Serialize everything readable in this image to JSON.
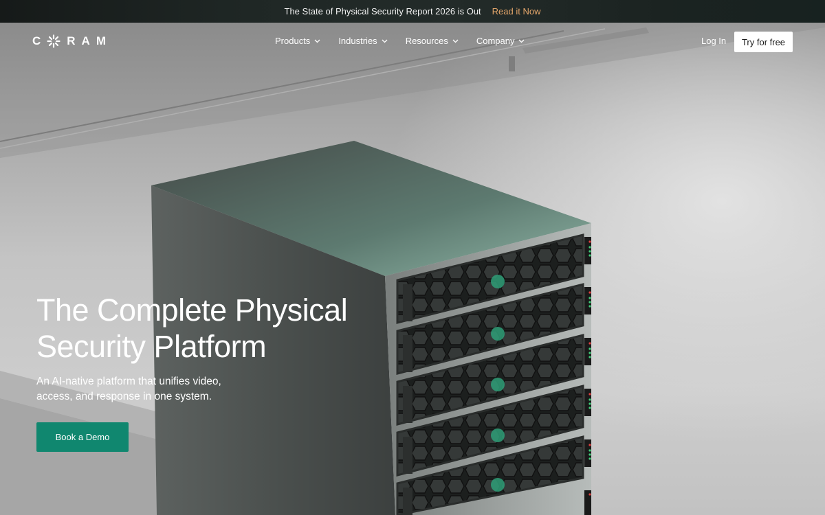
{
  "announcement": {
    "message": "The State of Physical Security Report 2026 is Out",
    "link_label": "Read it Now"
  },
  "brand": {
    "name": "CORAM",
    "wordmark_tail": "RAM"
  },
  "nav": {
    "items": [
      {
        "label": "Products"
      },
      {
        "label": "Industries"
      },
      {
        "label": "Resources"
      },
      {
        "label": "Company"
      }
    ],
    "login_label": "Log In",
    "trial_label": "Try for free"
  },
  "hero": {
    "title_line1": "The Complete Physical",
    "title_line2": "Security Platform",
    "subtitle": "An AI-native platform that unifies video, access, and response in one system.",
    "cta_label": "Book a Demo"
  },
  "colors": {
    "accent": "#10876f",
    "link": "#e3a56a",
    "announce_bg": "#1f2725"
  },
  "icons": [
    "logo-burst-icon",
    "chevron-down-icon",
    "server-rack-image"
  ]
}
